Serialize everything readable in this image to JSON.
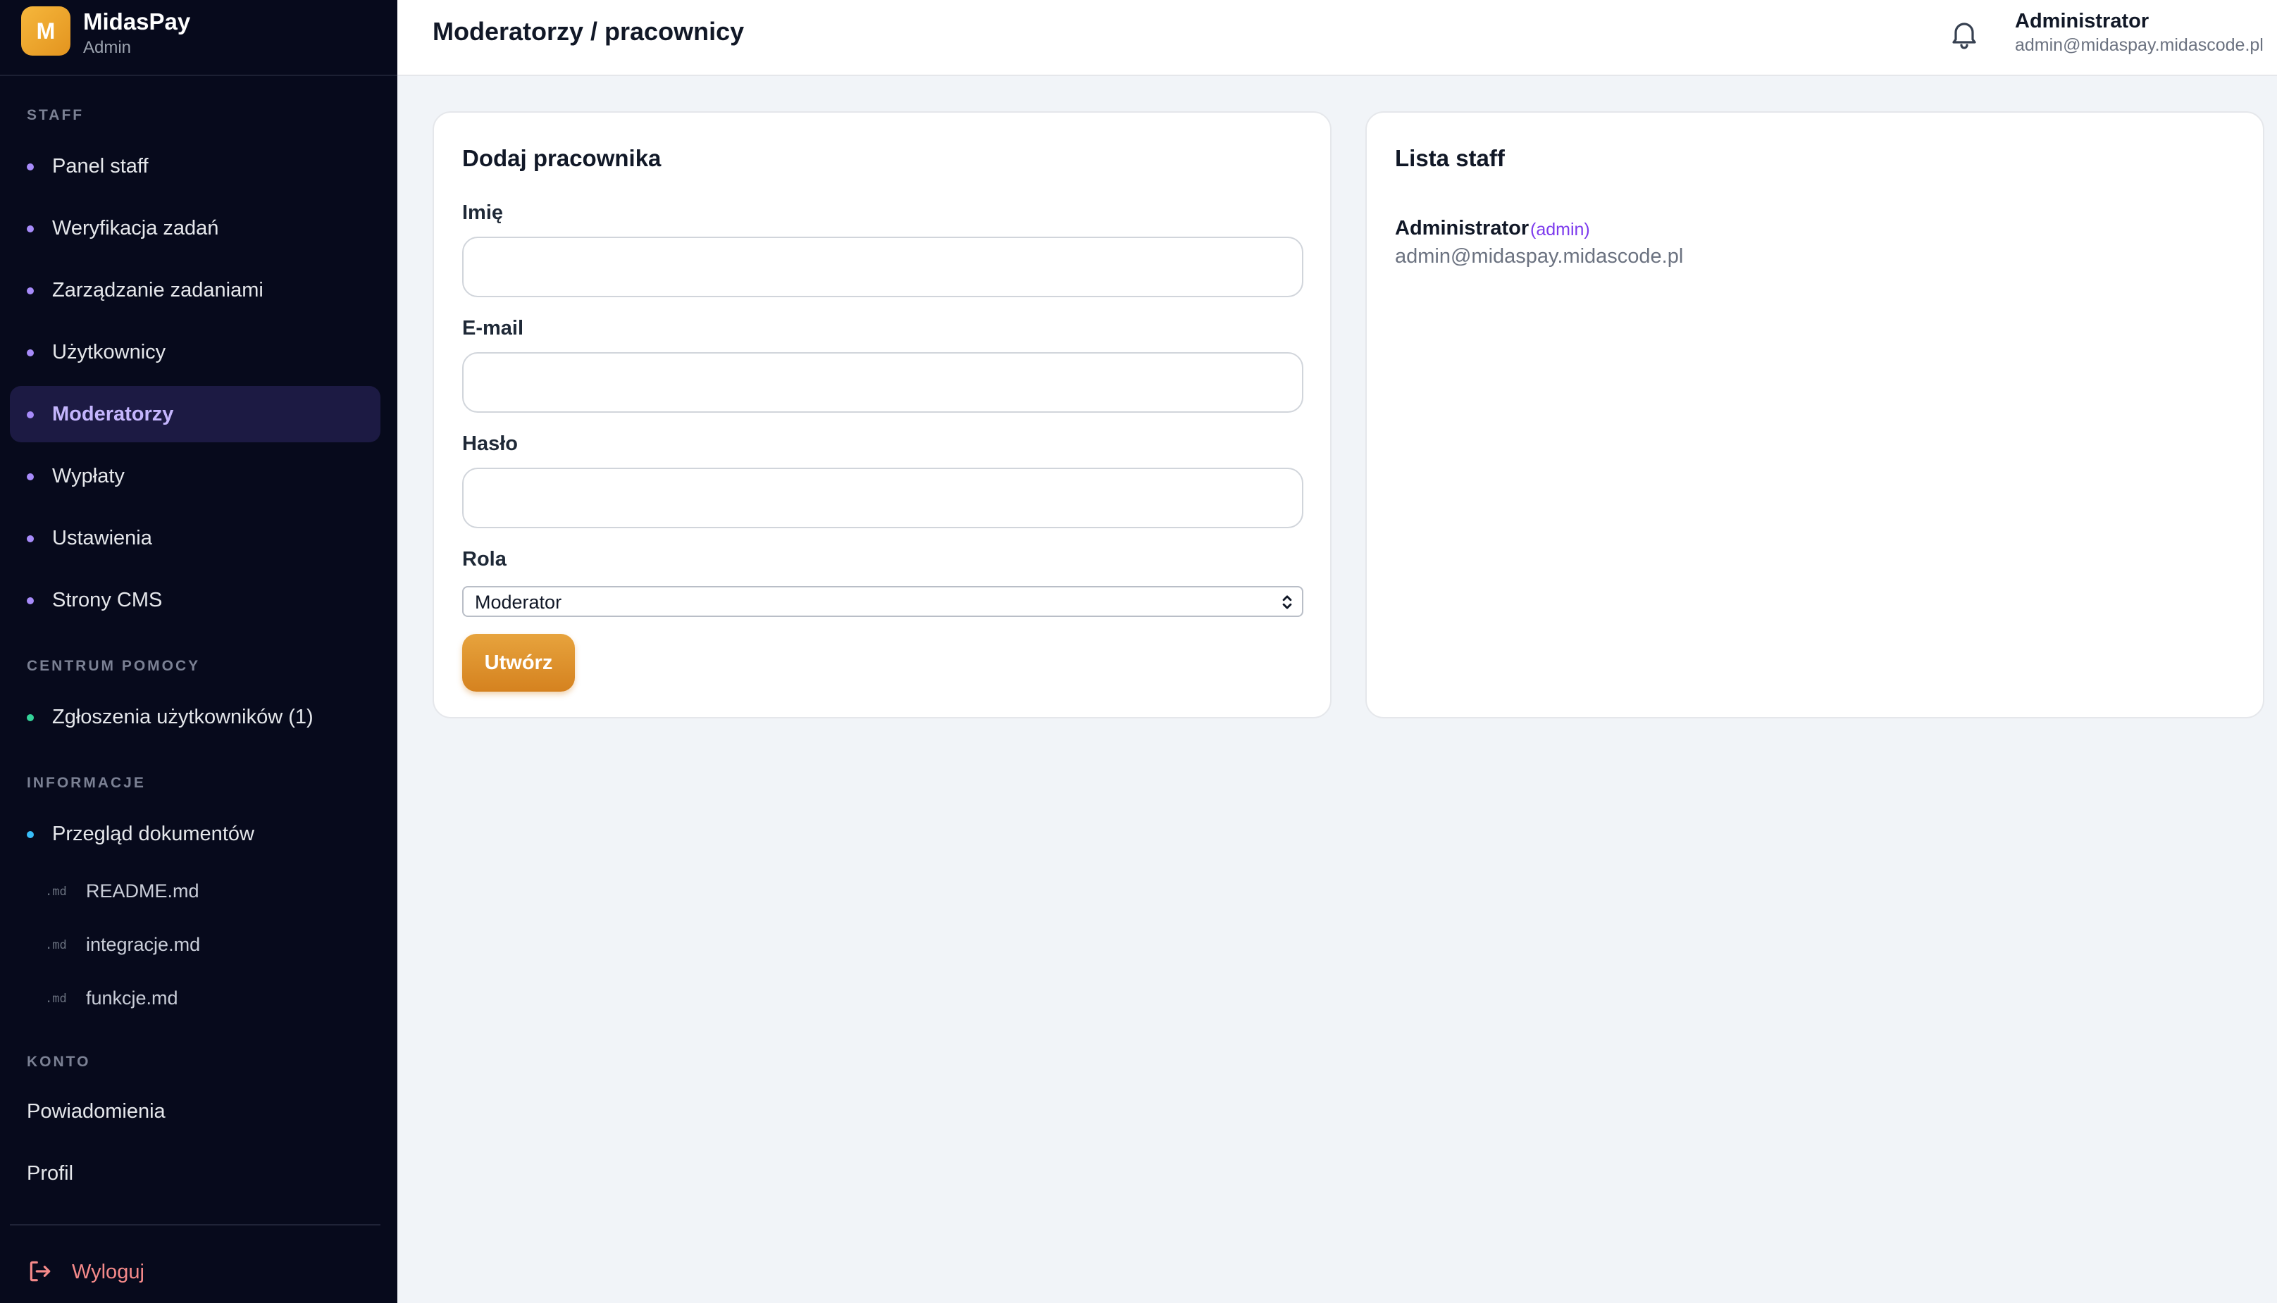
{
  "brand": {
    "logo_letter": "M",
    "name": "MidasPay",
    "subtitle": "Admin"
  },
  "sidebar": {
    "sections": {
      "staff": "STAFF",
      "help": "CENTRUM POMOCY",
      "info": "INFORMACJE",
      "account": "KONTO"
    },
    "staff_items": [
      {
        "label": "Panel staff",
        "dot_color": "#a78bfa"
      },
      {
        "label": "Weryfikacja zadań",
        "dot_color": "#a78bfa"
      },
      {
        "label": "Zarządzanie zadaniami",
        "dot_color": "#a78bfa"
      },
      {
        "label": "Użytkownicy",
        "dot_color": "#a78bfa"
      },
      {
        "label": "Moderatorzy",
        "dot_color": "#a78bfa",
        "active": true
      },
      {
        "label": "Wypłaty",
        "dot_color": "#a78bfa"
      },
      {
        "label": "Ustawienia",
        "dot_color": "#a78bfa"
      },
      {
        "label": "Strony CMS",
        "dot_color": "#a78bfa"
      }
    ],
    "help_items": [
      {
        "label": "Zgłoszenia użytkowników (1)",
        "dot_color": "#34d399"
      }
    ],
    "info_items": [
      {
        "label": "Przegląd dokumentów",
        "dot_color": "#38bdf8"
      }
    ],
    "docs": [
      {
        "ext": ".md",
        "label": "README.md"
      },
      {
        "ext": ".md",
        "label": "integracje.md"
      },
      {
        "ext": ".md",
        "label": "funkcje.md"
      }
    ],
    "account_items": [
      {
        "label": "Powiadomienia"
      },
      {
        "label": "Profil"
      }
    ],
    "logout_label": "Wyloguj"
  },
  "header": {
    "title": "Moderatorzy / pracownicy",
    "user_name": "Administrator",
    "user_email": "admin@midaspay.midascode.pl"
  },
  "form": {
    "title": "Dodaj pracownika",
    "name_label": "Imię",
    "name_value": "",
    "email_label": "E-mail",
    "email_value": "",
    "password_label": "Hasło",
    "password_value": "",
    "role_label": "Rola",
    "role_value": "Moderator",
    "submit_label": "Utwórz"
  },
  "staff_list": {
    "title": "Lista staff",
    "members": [
      {
        "name": "Administrator",
        "role": "(admin)",
        "email": "admin@midaspay.midascode.pl"
      }
    ]
  },
  "colors": {
    "sidebar_bg": "#070a1c",
    "accent": "#e39a2e",
    "active_item_bg": "#1c1a43",
    "active_item_text": "#c4b5fd",
    "logout": "#f58a8a",
    "role_badge": "#7c3aed"
  },
  "icons": {
    "bell": "bell-icon",
    "logout": "logout-icon",
    "select": "chevron-up-down-icon"
  }
}
